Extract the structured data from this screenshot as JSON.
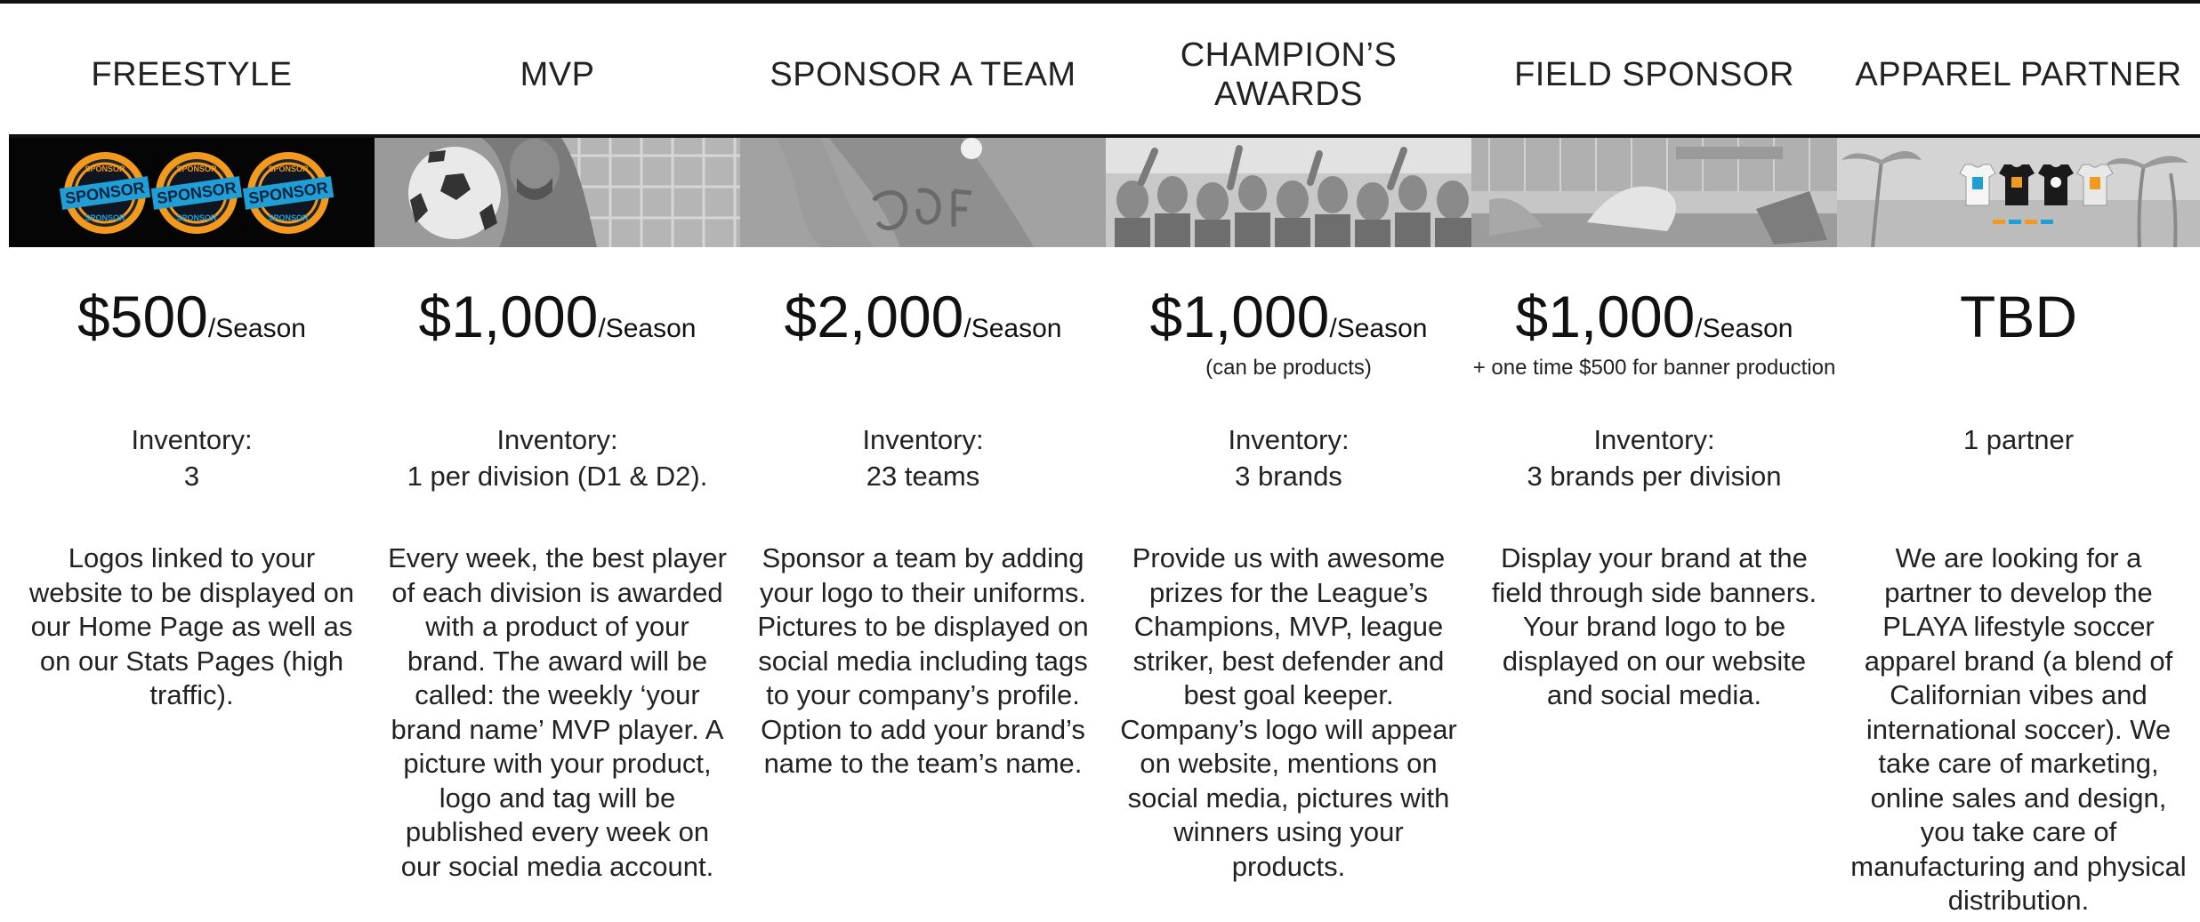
{
  "tiers": [
    {
      "title": "FREESTYLE",
      "image": "sponsor-badges",
      "price": "$500",
      "period": "/Season",
      "price_note": "",
      "inventory_label": "Inventory:",
      "inventory_value": "3",
      "description": "Logos linked to your website to be displayed on our Home Page as well as on our Stats Pages (high traffic)."
    },
    {
      "title": "MVP",
      "image": "soccer-ball-player-photo",
      "price": "$1,000",
      "period": "/Season",
      "price_note": "",
      "inventory_label": "Inventory:",
      "inventory_value": "1 per division (D1 & D2).",
      "description": "Every week, the best player of each division is awarded with a product of your brand. The award will be called: the weekly ‘your brand name’ MVP player. A picture with your product, logo and tag will be published every week on our social media account."
    },
    {
      "title": "SPONSOR A TEAM",
      "image": "team-jersey-photo",
      "price": "$2,000",
      "period": "/Season",
      "price_note": "",
      "inventory_label": "Inventory:",
      "inventory_value": "23 teams",
      "description": "Sponsor a team by adding your logo to their uniforms. Pictures to be displayed on social media including tags to your company’s profile. Option to add your brand’s name to the team’s name."
    },
    {
      "title": "CHAMPION’S AWARDS",
      "image": "celebrating-crowd-photo",
      "price": "$1,000",
      "period": "/Season",
      "price_note": "(can be products)",
      "inventory_label": "Inventory:",
      "inventory_value": "3 brands",
      "description": "Provide us with awesome prizes for the League’s Champions, MVP, league striker, best defender and best goal keeper. Company’s logo will appear on website, mentions on social media, pictures with winners using your products."
    },
    {
      "title": "FIELD SPONSOR",
      "image": "field-banner-photo",
      "price": "$1,000",
      "period": "/Season",
      "price_note": "+ one time $500 for banner production",
      "inventory_label": "Inventory:",
      "inventory_value": "3 brands per division",
      "description": "Display your brand at the field through side banners. Your brand logo to be displayed on our website and social media."
    },
    {
      "title": "APPAREL PARTNER",
      "image": "palm-trees-tshirts-photo",
      "price": "TBD",
      "period": "",
      "price_note": "",
      "inventory_label": "",
      "inventory_value": "1 partner",
      "description": "We are looking for a partner to develop the PLAYA lifestyle soccer apparel brand (a blend of Californian vibes and international soccer). We take care of marketing, online sales and design, you take care of manufacturing and physical distribution."
    }
  ],
  "badges": {
    "arc_top": "SPONSOR",
    "band": "SPONSOR",
    "arc_bottom": "SPONSOR"
  },
  "colors": {
    "badge_band": "#1f9fd6",
    "badge_ring": "#f39a1e",
    "rule": "#111111"
  }
}
